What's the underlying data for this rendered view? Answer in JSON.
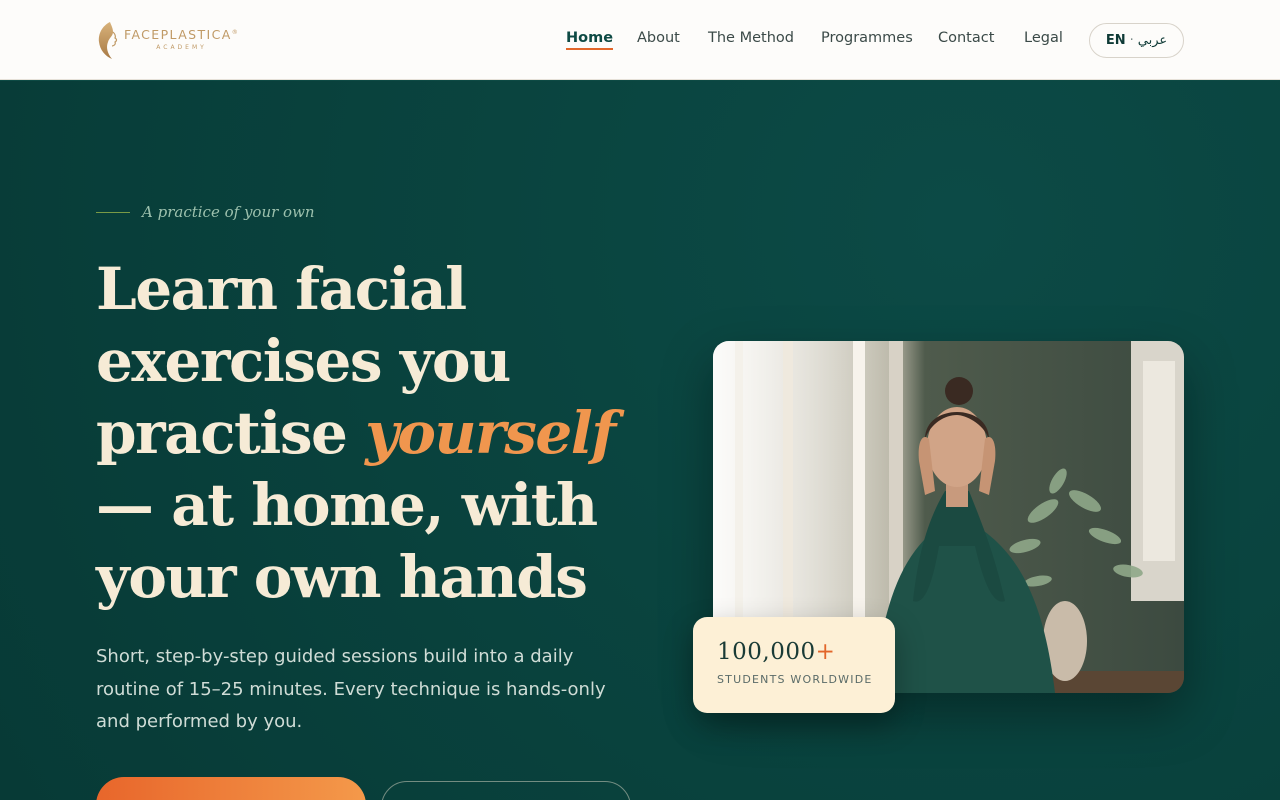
{
  "brand": {
    "name": "FACEPLASTICA",
    "trademark": "®",
    "sub": "ACADEMY"
  },
  "nav": {
    "items": [
      {
        "label": "Home",
        "active": true
      },
      {
        "label": "About",
        "active": false
      },
      {
        "label": "The Method",
        "active": false
      },
      {
        "label": "Programmes",
        "active": false
      },
      {
        "label": "Contact",
        "active": false
      },
      {
        "label": "Legal",
        "active": false
      }
    ],
    "lang": {
      "current": "EN",
      "separator": "·",
      "alt": "عربي"
    }
  },
  "hero": {
    "eyebrow": "A practice of your own",
    "headline": {
      "before": "Learn facial exercises you practise ",
      "accent": "yourself",
      "after": " — at home, with your own hands"
    },
    "lead": "Short, step-by-step guided sessions build into a daily routine of 15–25 minutes. Every technique is hands-only and performed by you.",
    "stat": {
      "value": "100,000",
      "suffix": "+",
      "label": "STUDENTS WORLDWIDE"
    }
  },
  "colors": {
    "brand_gold": "#c09a66",
    "hero_bg": "#0a4540",
    "accent_orange": "#f0964e",
    "cream": "#f6ebd6"
  }
}
